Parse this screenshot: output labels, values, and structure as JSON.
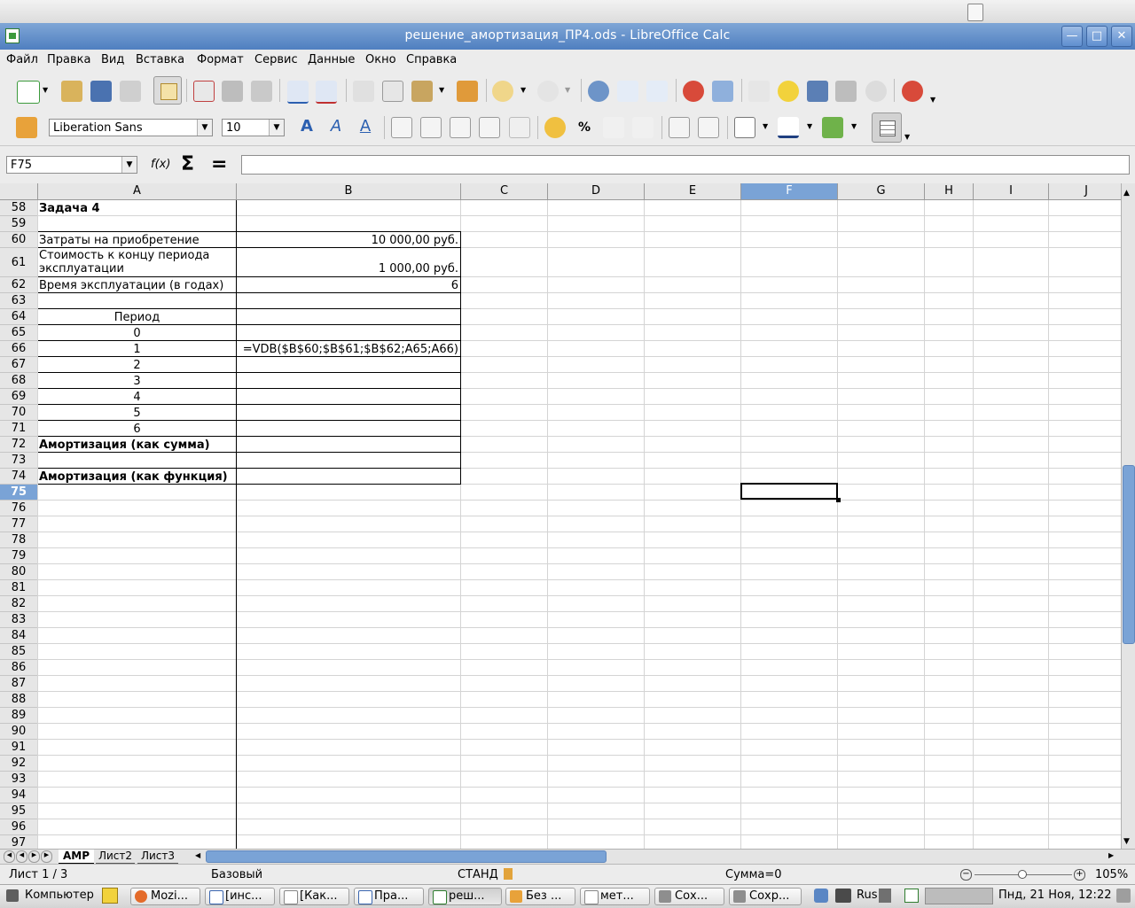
{
  "window": {
    "title": "решение_амортизация_ПР4.ods - LibreOffice Calc"
  },
  "menu": [
    "Файл",
    "Правка",
    "Вид",
    "Вставка",
    "Формат",
    "Сервис",
    "Данные",
    "Окно",
    "Справка"
  ],
  "format_toolbar": {
    "font_name": "Liberation Sans",
    "font_size": "10",
    "percent_symbol": "%"
  },
  "formula_bar": {
    "name_box": "F75",
    "function_symbol": "f(x)",
    "sum_symbol": "Σ",
    "equals_symbol": "=",
    "formula": ""
  },
  "columns": [
    "A",
    "B",
    "C",
    "D",
    "E",
    "F",
    "G",
    "H",
    "I",
    "J"
  ],
  "selected_column": "F",
  "rows": [
    "58",
    "59",
    "60",
    "61",
    "62",
    "63",
    "64",
    "65",
    "66",
    "67",
    "68",
    "69",
    "70",
    "71",
    "72",
    "73",
    "74",
    "75",
    "76",
    "77",
    "78",
    "79",
    "80",
    "81",
    "82",
    "83",
    "84",
    "85",
    "86",
    "87",
    "88",
    "89",
    "90",
    "91",
    "92",
    "93",
    "94",
    "95",
    "96",
    "97"
  ],
  "selected_row": "75",
  "cells": {
    "A58": "Задача 4",
    "A60": "Затраты на приобретение",
    "B60": "10 000,00 руб.",
    "A61_line1": "Стоимость к концу периода",
    "A61_line2": "эксплуатации",
    "B61": "1 000,00 руб.",
    "A62": "Время эксплуатации (в годах)",
    "B62": "6",
    "A64": "Период",
    "A65": "0",
    "A66": "1",
    "B66": "=VDB($B$60;$B$61;$B$62;A65;A66)",
    "A67": "2",
    "A68": "3",
    "A69": "4",
    "A70": "5",
    "A71": "6",
    "A72": "Амортизация (как сумма)",
    "A74": "Амортизация (как функция)"
  },
  "sheet_tabs": [
    "АМР",
    "Лист2",
    "Лист3"
  ],
  "status": {
    "sheet": "Лист 1 / 3",
    "style": "Базовый",
    "mode": "СТАНД",
    "sum": "Сумма=0",
    "zoom": "105%"
  },
  "taskbar": {
    "start": "Компьютер",
    "tasks": [
      "Mozi...",
      "[инс...",
      "[Как...",
      "Пра...",
      "реш...",
      "Без ...",
      "мет...",
      "Сох...",
      "Сохр..."
    ],
    "lang": "Rus",
    "clock": "Пнд, 21 Ноя, 12:22"
  },
  "colors": {
    "title_bar": "#5b88c6",
    "selection": "#7aa3d6"
  }
}
